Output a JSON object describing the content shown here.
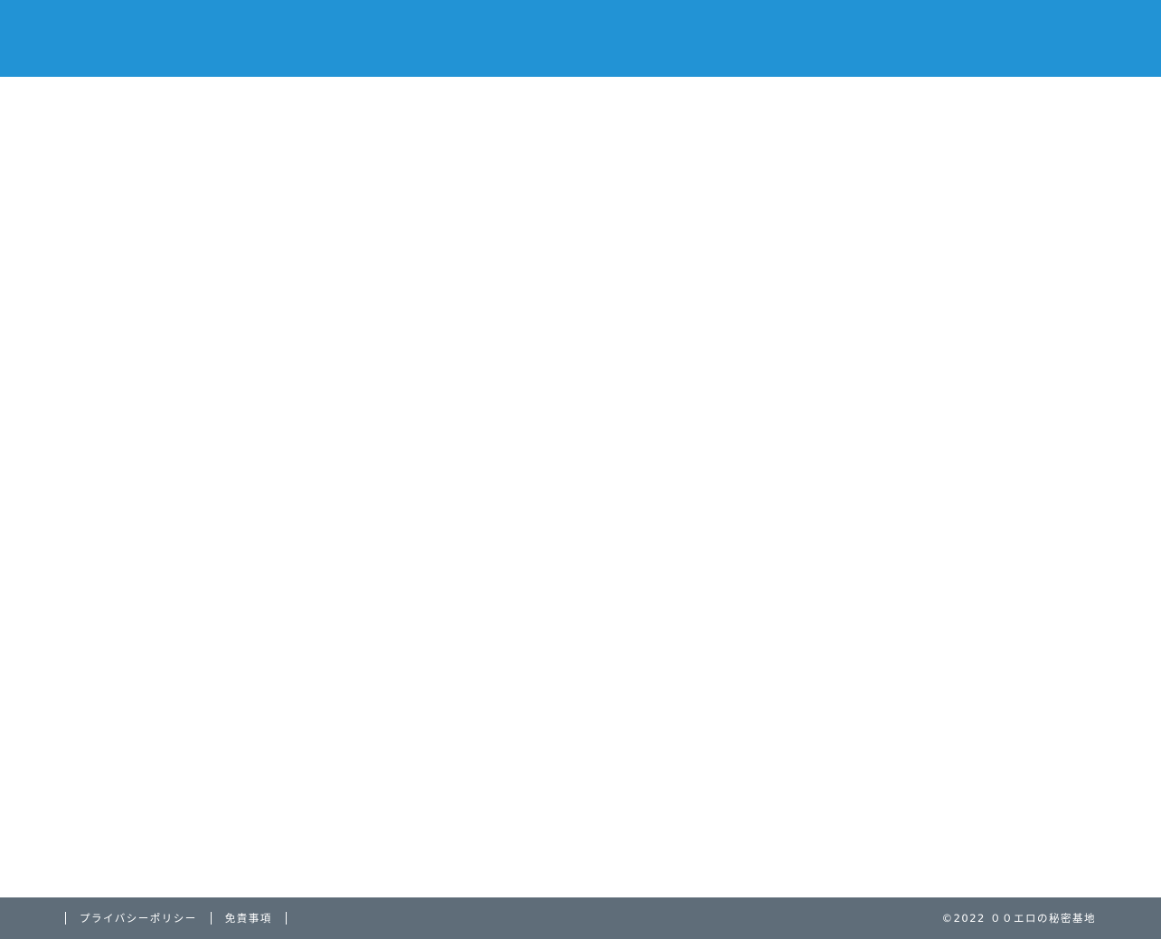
{
  "footer": {
    "links": [
      {
        "label": "プライバシーポリシー"
      },
      {
        "label": "免責事項"
      }
    ],
    "copyright": "©2022 ００エロの秘密基地"
  },
  "colors": {
    "header_bg": "#2293d5",
    "footer_bg": "#5f6d79",
    "footer_text": "#ffffff"
  }
}
